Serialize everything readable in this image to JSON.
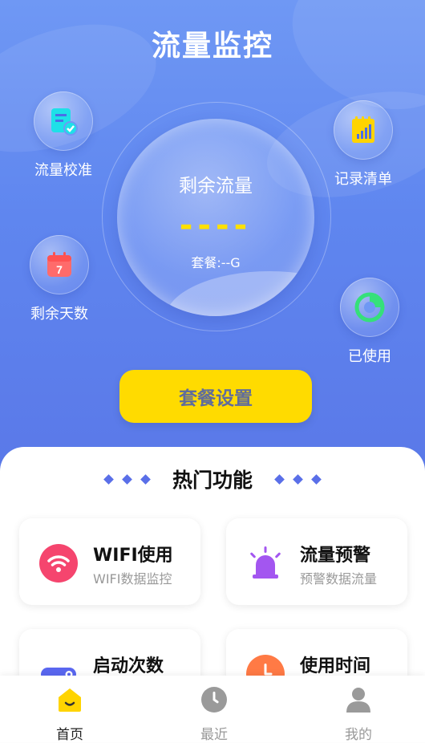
{
  "app": {
    "title": "流量监控"
  },
  "features": {
    "calibrate": {
      "label": "流量校准",
      "icon": "document-check-icon"
    },
    "records": {
      "label": "记录清单",
      "icon": "bar-chart-doc-icon"
    },
    "days_left": {
      "label": "剩余天数",
      "icon": "calendar-icon",
      "calendar_day": "7"
    },
    "used": {
      "label": "已使用",
      "icon": "pie-chart-icon"
    }
  },
  "gauge": {
    "title": "剩余流量",
    "value": "----",
    "plan": "套餐:--G"
  },
  "plan_button": {
    "label": "套餐设置"
  },
  "hot": {
    "title": "热门功能",
    "cards": [
      {
        "title": "WIFI使用",
        "subtitle": "WIFI数据监控",
        "icon": "wifi-icon",
        "color": "#f5456e"
      },
      {
        "title": "流量预警",
        "subtitle": "预警数据流量",
        "icon": "alarm-light-icon",
        "color": "#a356f0"
      },
      {
        "title": "启动次数",
        "subtitle": "",
        "icon": "toggle-icon",
        "color": "#5a67f0"
      },
      {
        "title": "使用时间",
        "subtitle": "",
        "icon": "clock-icon",
        "color": "#ff7a45"
      }
    ]
  },
  "tabs": [
    {
      "label": "首页",
      "icon": "home-icon",
      "active": true
    },
    {
      "label": "最近",
      "icon": "clock-icon",
      "active": false
    },
    {
      "label": "我的",
      "icon": "user-icon",
      "active": false
    }
  ],
  "colors": {
    "accent_yellow": "#ffdb00",
    "hero_blue": "#6f98f4"
  }
}
